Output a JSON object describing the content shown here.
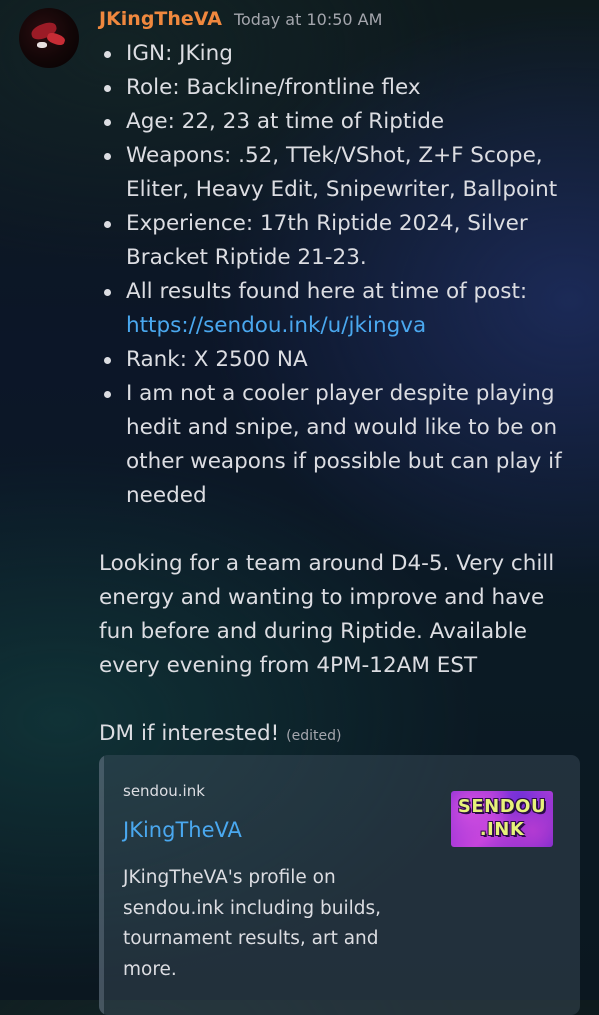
{
  "message": {
    "author": "JKingTheVA",
    "timestamp": "Today at 10:50 AM",
    "info_items": [
      "IGN: JKing",
      "Role: Backline/frontline flex",
      "Age: 22, 23 at time of Riptide",
      "Weapons: .52, TTek/VShot, Z+F Scope, Eliter, Heavy Edit, Snipewriter, Ballpoint",
      "Experience: 17th Riptide 2024, Silver Bracket Riptide 21-23.",
      "All results found here at time of post:",
      "Rank: X 2500 NA",
      "I am not a cooler player despite playing hedit and snipe, and would like to be on other weapons if possible but can play if needed"
    ],
    "results_link": "https://sendou.ink/u/jkingva",
    "paragraph_team": "Looking for a team around D4-5. Very chill energy and wanting to improve and have fun before and during Riptide. Available every evening from 4PM-12AM EST",
    "paragraph_dm": "DM if interested!",
    "edited_label": "(edited)"
  },
  "embed": {
    "provider": "sendou.ink",
    "title": "JKingTheVA",
    "description": "JKingTheVA's profile on sendou.ink including builds, tournament results, art and more.",
    "thumbnail_text_line1": "SENDOU",
    "thumbnail_text_line2": ".INK"
  },
  "colors": {
    "username": "#f0883e",
    "link": "#4aa8ef",
    "text": "#dcdde2",
    "muted": "#a4a6ad"
  }
}
